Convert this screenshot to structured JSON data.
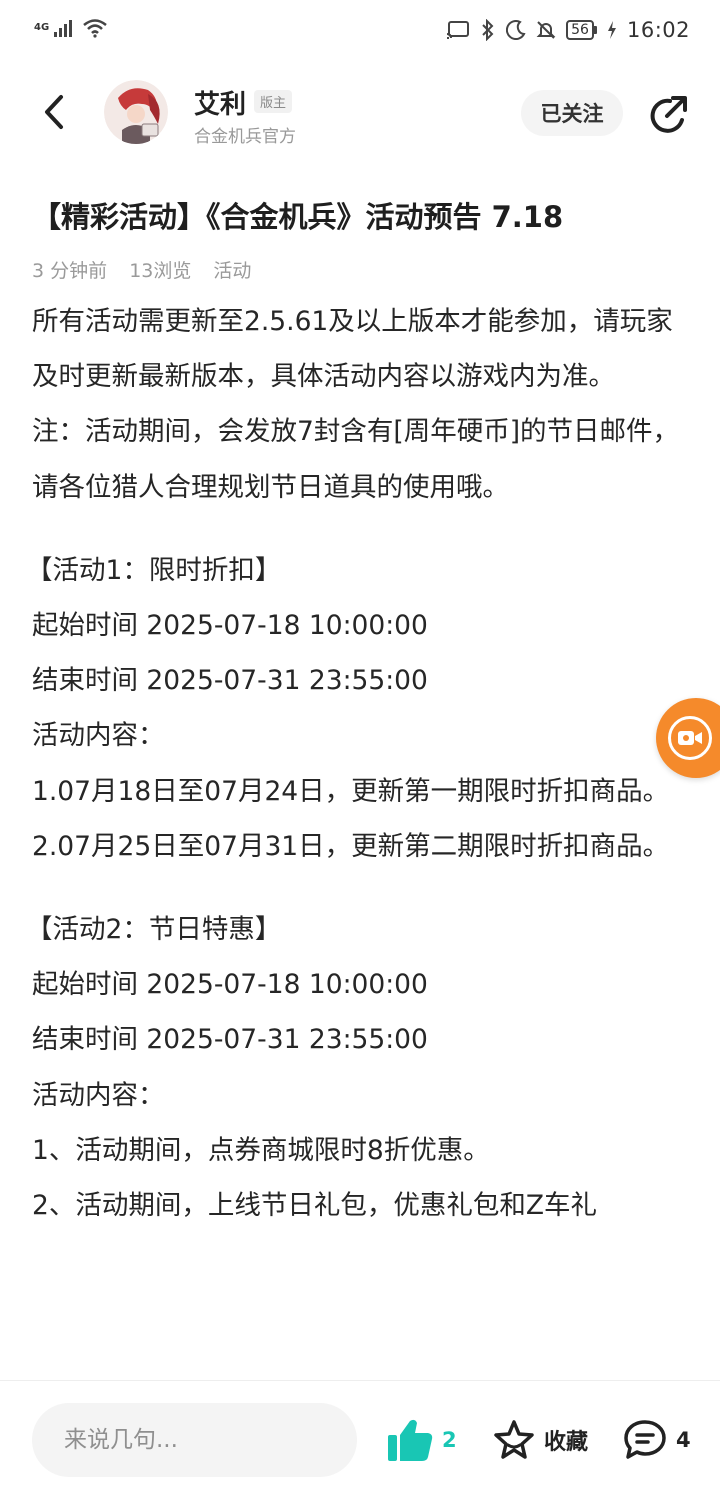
{
  "status_bar": {
    "network": "4G",
    "battery": "56",
    "time": "16:02"
  },
  "header": {
    "author_name": "艾利",
    "author_role": "版主",
    "author_subtitle": "合金机兵官方",
    "follow_label": "已关注"
  },
  "article": {
    "title": "【精彩活动】《合金机兵》活动预告 7.18",
    "meta": {
      "time": "3 分钟前",
      "views": "13浏览",
      "tag": "活动"
    },
    "paragraphs": [
      "所有活动需更新至2.5.61及以上版本才能参加，请玩家及时更新最新版本，具体活动内容以游戏内为准。",
      "注：活动期间，会发放7封含有[周年硬币]的节日邮件，请各位猎人合理规划节日道具的使用哦。",
      "【活动1：限时折扣】",
      "起始时间 2025-07-18 10:00:00",
      "结束时间 2025-07-31 23:55:00",
      "活动内容：",
      "1.07月18日至07月24日，更新第一期限时折扣商品。",
      "2.07月25日至07月31日，更新第二期限时折扣商品。",
      "【活动2：节日特惠】",
      "起始时间 2025-07-18 10:00:00",
      "结束时间 2025-07-31 23:55:00",
      "活动内容：",
      "1、活动期间，点券商城限时8折优惠。",
      "2、活动期间，上线节日礼包，优惠礼包和Z车礼"
    ]
  },
  "bottom_bar": {
    "comment_placeholder": "来说几句...",
    "like_count": "2",
    "favorite_label": "收藏",
    "comment_count": "4"
  },
  "colors": {
    "accent": "#19c6b4",
    "float_button": "#f58a2b"
  }
}
